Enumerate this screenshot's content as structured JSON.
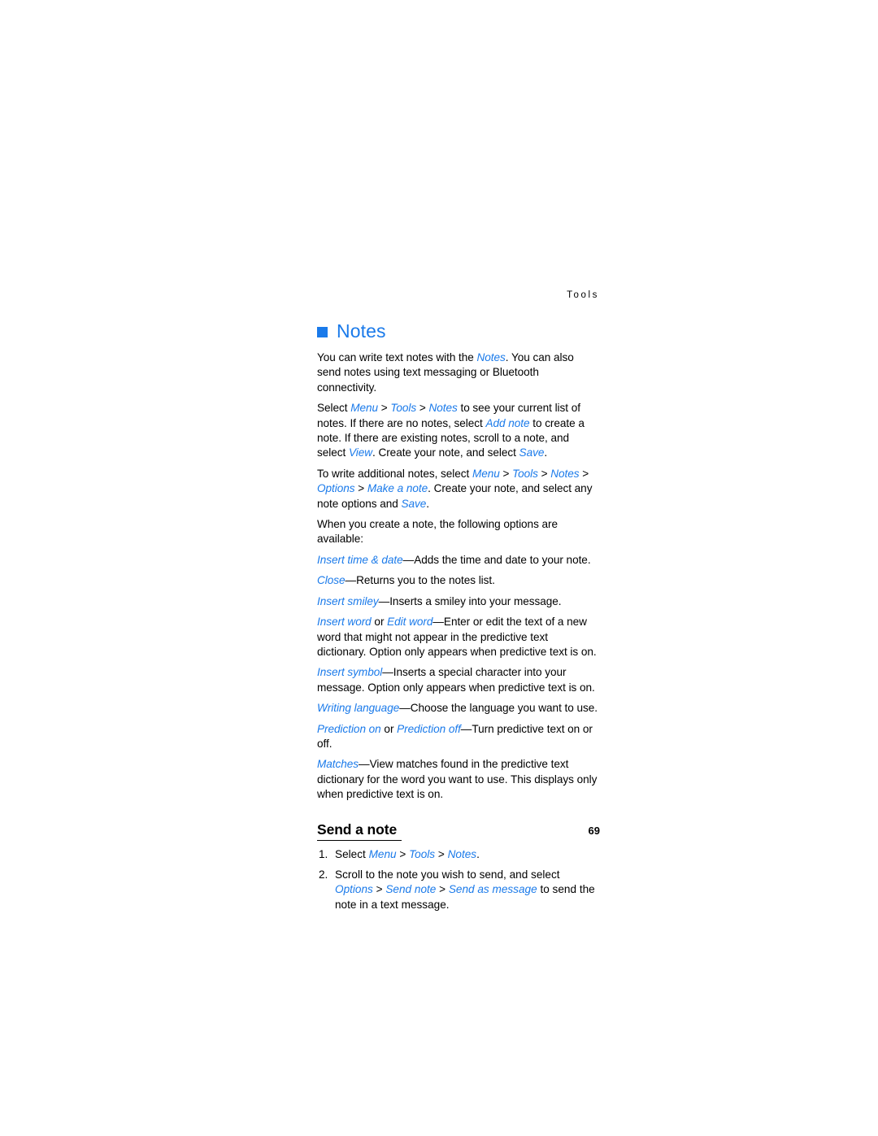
{
  "page": {
    "running_head": "Tools",
    "folio": "69",
    "accent_color": "#1a7aea",
    "text_color": "#000000",
    "background_color": "#ffffff"
  },
  "chapter": {
    "bullet": "square-bullet",
    "title": "Notes"
  },
  "paragraphs": [
    {
      "name": "intro-paragraph",
      "runs": [
        {
          "t": "You can write text notes with the "
        },
        {
          "t": "Notes",
          "s": "ui"
        },
        {
          "t": ". You can also send notes using text messaging or Bluetooth connectivity."
        }
      ]
    },
    {
      "name": "select-notes-paragraph",
      "runs": [
        {
          "t": "Select "
        },
        {
          "t": "Menu",
          "s": "ui"
        },
        {
          "t": " > ",
          "s": "gt"
        },
        {
          "t": "Tools",
          "s": "ui"
        },
        {
          "t": " > ",
          "s": "gt"
        },
        {
          "t": "Notes",
          "s": "ui"
        },
        {
          "t": " to see your current list of notes. If there are no notes, select "
        },
        {
          "t": "Add note",
          "s": "ui"
        },
        {
          "t": " to create a note. If there are existing notes, scroll to a note, and select "
        },
        {
          "t": "View",
          "s": "ui"
        },
        {
          "t": ". Create your note, and select "
        },
        {
          "t": "Save",
          "s": "ui"
        },
        {
          "t": "."
        }
      ]
    },
    {
      "name": "additional-notes-paragraph",
      "runs": [
        {
          "t": "To write additional notes, select "
        },
        {
          "t": "Menu",
          "s": "ui"
        },
        {
          "t": " > ",
          "s": "gt"
        },
        {
          "t": "Tools",
          "s": "ui"
        },
        {
          "t": " > ",
          "s": "gt"
        },
        {
          "t": "Notes",
          "s": "ui"
        },
        {
          "t": " > ",
          "s": "gt"
        },
        {
          "t": "Options",
          "s": "ui"
        },
        {
          "t": " > ",
          "s": "gt"
        },
        {
          "t": "Make a note",
          "s": "ui"
        },
        {
          "t": ". Create your note, and select any note options and "
        },
        {
          "t": "Save",
          "s": "ui"
        },
        {
          "t": "."
        }
      ]
    },
    {
      "name": "options-available-paragraph",
      "runs": [
        {
          "t": "When you create a note, the following options are available:"
        }
      ]
    },
    {
      "name": "option-insert-time-date",
      "runs": [
        {
          "t": "Insert time & date",
          "s": "ui"
        },
        {
          "t": "—",
          "s": "dash"
        },
        {
          "t": "Adds the time and date to your note."
        }
      ]
    },
    {
      "name": "option-close",
      "runs": [
        {
          "t": "Close",
          "s": "ui"
        },
        {
          "t": "—",
          "s": "dash"
        },
        {
          "t": "Returns you to the notes list."
        }
      ]
    },
    {
      "name": "option-insert-smiley",
      "runs": [
        {
          "t": "Insert smiley",
          "s": "ui"
        },
        {
          "t": "—",
          "s": "dash"
        },
        {
          "t": "Inserts a smiley into your message."
        }
      ]
    },
    {
      "name": "option-insert-word",
      "runs": [
        {
          "t": "Insert word",
          "s": "ui"
        },
        {
          "t": " or "
        },
        {
          "t": "Edit word",
          "s": "ui"
        },
        {
          "t": "—",
          "s": "dash"
        },
        {
          "t": "Enter or edit the text of a new word that might not appear in the predictive text dictionary. Option only appears when predictive text is on."
        }
      ]
    },
    {
      "name": "option-insert-symbol",
      "runs": [
        {
          "t": "Insert symbol",
          "s": "ui"
        },
        {
          "t": "—",
          "s": "dash"
        },
        {
          "t": "Inserts a special character into your message. Option only appears when predictive text is on."
        }
      ]
    },
    {
      "name": "option-writing-language",
      "runs": [
        {
          "t": "Writing language",
          "s": "ui"
        },
        {
          "t": "—",
          "s": "dash"
        },
        {
          "t": "Choose the language you want to use."
        }
      ]
    },
    {
      "name": "option-prediction",
      "runs": [
        {
          "t": "Prediction on",
          "s": "ui"
        },
        {
          "t": " or "
        },
        {
          "t": "Prediction off",
          "s": "ui"
        },
        {
          "t": "—",
          "s": "dash"
        },
        {
          "t": "Turn predictive text on or off."
        }
      ]
    },
    {
      "name": "option-matches",
      "runs": [
        {
          "t": "Matches",
          "s": "ui"
        },
        {
          "t": "—",
          "s": "dash"
        },
        {
          "t": "View matches found in the predictive text dictionary for the word you want to use. This displays only when predictive text is on."
        }
      ]
    }
  ],
  "section": {
    "heading": "Send a note",
    "steps": [
      {
        "number": "1.",
        "name": "step-select-notes",
        "runs": [
          {
            "t": "Select "
          },
          {
            "t": "Menu",
            "s": "ui"
          },
          {
            "t": " > ",
            "s": "gt"
          },
          {
            "t": "Tools",
            "s": "ui"
          },
          {
            "t": " > ",
            "s": "gt"
          },
          {
            "t": "Notes",
            "s": "ui"
          },
          {
            "t": "."
          }
        ]
      },
      {
        "number": "2.",
        "name": "step-send-as-message",
        "runs": [
          {
            "t": "Scroll to the note you wish to send, and select "
          },
          {
            "t": "Options",
            "s": "ui"
          },
          {
            "t": " > ",
            "s": "gt"
          },
          {
            "t": "Send note",
            "s": "ui"
          },
          {
            "t": " > ",
            "s": "gt"
          },
          {
            "t": "Send as message",
            "s": "ui"
          },
          {
            "t": " to send the note in a text message."
          }
        ]
      }
    ]
  }
}
